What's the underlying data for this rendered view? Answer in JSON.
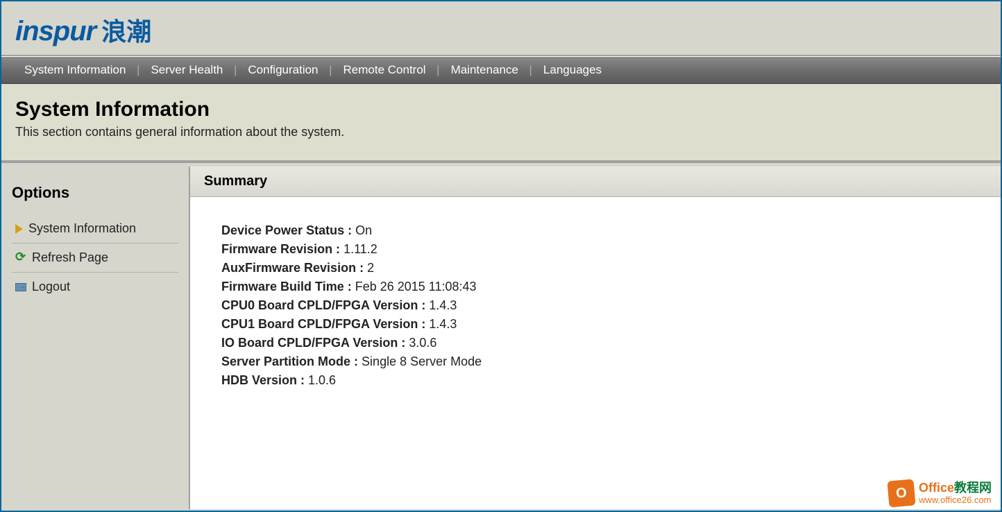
{
  "logo": {
    "text": "inspur",
    "cn": "浪潮"
  },
  "nav": {
    "items": [
      "System Information",
      "Server Health",
      "Configuration",
      "Remote Control",
      "Maintenance",
      "Languages"
    ]
  },
  "page": {
    "title": "System Information",
    "subtitle": "This section contains general information about the system."
  },
  "sidebar": {
    "title": "Options",
    "items": [
      {
        "label": "System Information",
        "icon": "triangle"
      },
      {
        "label": "Refresh Page",
        "icon": "refresh"
      },
      {
        "label": "Logout",
        "icon": "logout"
      }
    ]
  },
  "panel": {
    "title": "Summary",
    "rows": [
      {
        "label": "Device Power Status :",
        "value": " On"
      },
      {
        "label": "Firmware Revision :",
        "value": " 1.11.2"
      },
      {
        "label": "AuxFirmware Revision :",
        "value": " 2"
      },
      {
        "label": "Firmware Build Time :",
        "value": " Feb 26 2015 11:08:43"
      },
      {
        "label": "CPU0 Board CPLD/FPGA Version :",
        "value": " 1.4.3"
      },
      {
        "label": "CPU1 Board CPLD/FPGA Version :",
        "value": " 1.4.3"
      },
      {
        "label": "IO Board CPLD/FPGA Version :",
        "value": " 3.0.6"
      },
      {
        "label": "Server Partition Mode :",
        "value": " Single 8 Server Mode"
      },
      {
        "label": "HDB Version :",
        "value": " 1.0.6"
      }
    ]
  },
  "watermark": {
    "office": "Office",
    "cn": "教程网",
    "url": "www.office26.com",
    "icon_letter": "O"
  }
}
